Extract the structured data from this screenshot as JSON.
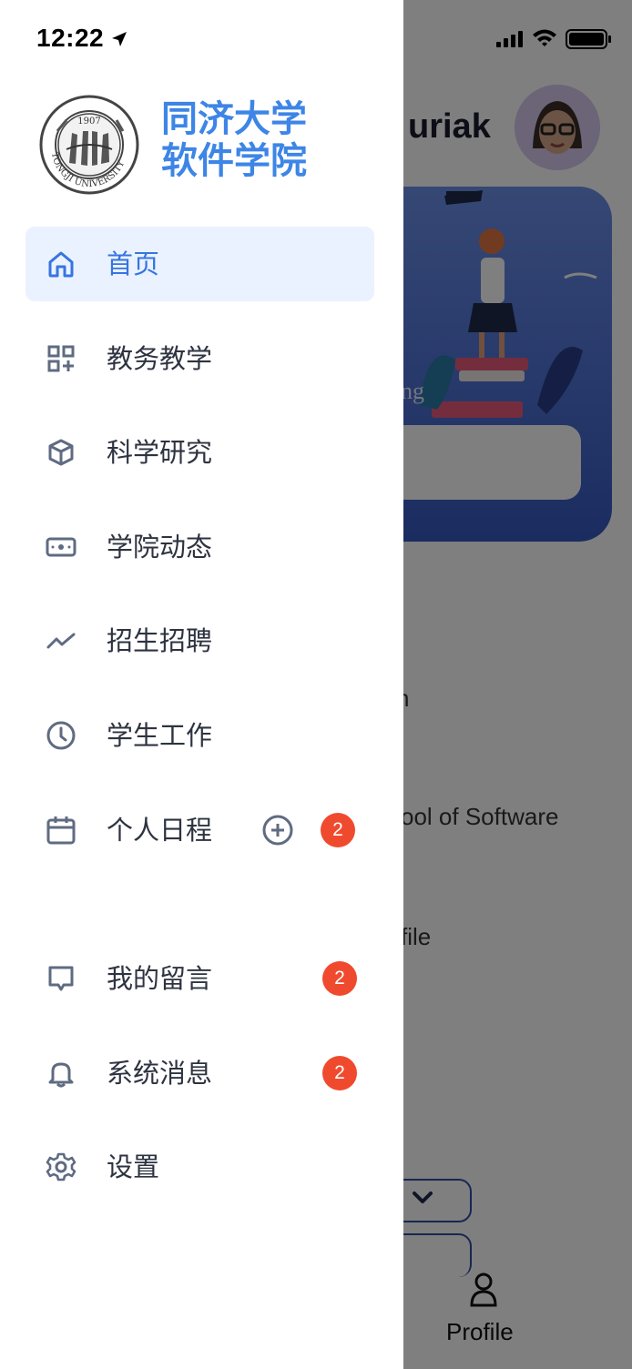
{
  "status_bar": {
    "time": "12:22"
  },
  "brand": {
    "name_line1": "同济大学",
    "name_line2": "软件学院"
  },
  "menu": {
    "items": [
      {
        "label": "首页",
        "icon": "home-icon",
        "active": true
      },
      {
        "label": "教务教学",
        "icon": "grid-plus-icon"
      },
      {
        "label": "科学研究",
        "icon": "cube-icon"
      },
      {
        "label": "学院动态",
        "icon": "cash-icon"
      },
      {
        "label": "招生招聘",
        "icon": "trend-line-icon"
      },
      {
        "label": "学生工作",
        "icon": "clock-icon"
      },
      {
        "label": "个人日程",
        "icon": "calendar-icon",
        "badge": "2"
      }
    ],
    "bottom_items": [
      {
        "label": "我的留言",
        "icon": "message-icon",
        "badge": "2"
      },
      {
        "label": "系统消息",
        "icon": "bell-icon",
        "badge": "2"
      },
      {
        "label": "设置",
        "icon": "gear-icon"
      }
    ]
  },
  "background": {
    "username_partial": "uriak",
    "banner_text_partial": "ng",
    "line1_partial": "n",
    "line2_partial": "ool of Software",
    "line3_partial": "file",
    "tab_profile_label": "Profile"
  },
  "colors": {
    "accent": "#3d85e6",
    "badge": "#f04a2e",
    "active_bg": "#eaf2ff",
    "icon": "#5f6b82"
  }
}
